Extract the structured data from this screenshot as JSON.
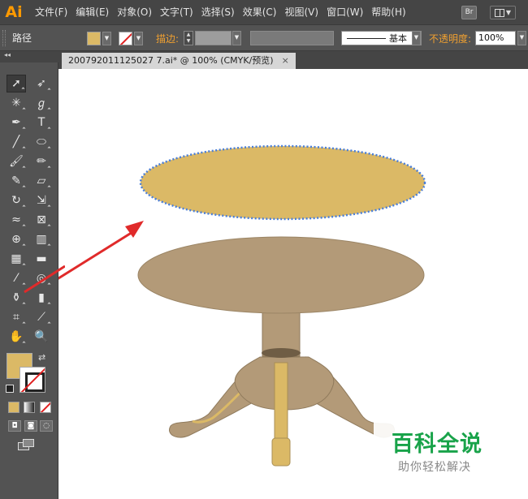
{
  "app": {
    "logo": "Ai",
    "colors": {
      "accent": "#ff9a00",
      "fill": "#dbb966",
      "table": "#b39a78",
      "selection": "#4a7ed8",
      "arrow": "#e02a2a"
    }
  },
  "menu": {
    "items": [
      "文件(F)",
      "编辑(E)",
      "对象(O)",
      "文字(T)",
      "选择(S)",
      "效果(C)",
      "视图(V)",
      "窗口(W)",
      "帮助(H)"
    ],
    "bridge": "Br"
  },
  "control": {
    "path_label": "路径",
    "stroke_label": "描边:",
    "brush_label": "基本",
    "opacity_label": "不透明度:",
    "opacity_value": "100%"
  },
  "toolbox": {
    "collapse": "◂◂"
  },
  "document": {
    "tab_title": "200792011125027 7.ai* @ 100% (CMYK/预览)",
    "close": "×"
  },
  "watermark": {
    "title": "百科全说",
    "subtitle": "助你轻松解决"
  }
}
